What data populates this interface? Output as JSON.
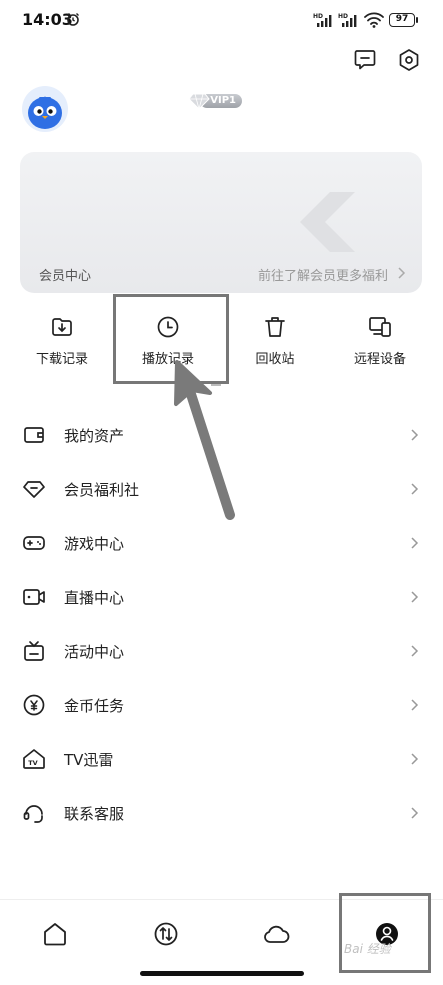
{
  "status": {
    "time": "14:03",
    "battery": "97",
    "signal1": "HD",
    "signal2": "HD"
  },
  "vip": {
    "badge": "VIP1",
    "card_label": "会员中心",
    "card_link": "前往了解会员更多福利"
  },
  "quick_actions": [
    {
      "label": "下载记录",
      "icon": "download-icon"
    },
    {
      "label": "播放记录",
      "icon": "clock-icon"
    },
    {
      "label": "回收站",
      "icon": "trash-icon"
    },
    {
      "label": "远程设备",
      "icon": "devices-icon"
    }
  ],
  "menu": [
    {
      "label": "我的资产",
      "icon": "wallet-icon"
    },
    {
      "label": "会员福利社",
      "icon": "gem-icon"
    },
    {
      "label": "游戏中心",
      "icon": "gamepad-icon"
    },
    {
      "label": "直播中心",
      "icon": "video-icon"
    },
    {
      "label": "活动中心",
      "icon": "tv-box-icon"
    },
    {
      "label": "金币任务",
      "icon": "coin-icon"
    },
    {
      "label": "TV迅雷",
      "icon": "tv-home-icon"
    },
    {
      "label": "联系客服",
      "icon": "headset-icon"
    }
  ],
  "bottom_nav": [
    {
      "icon": "home-icon"
    },
    {
      "icon": "transfer-icon"
    },
    {
      "icon": "cloud-icon"
    },
    {
      "icon": "profile-icon"
    }
  ],
  "watermark": "Bai 经验"
}
